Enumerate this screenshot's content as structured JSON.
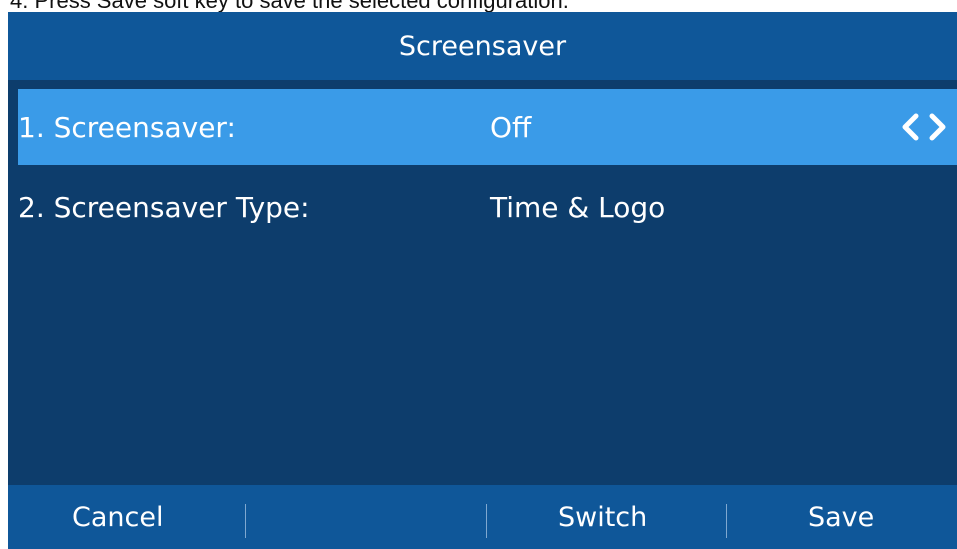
{
  "caption": "4. Press Save soft key to save the selected configuration.",
  "screen": {
    "title": "Screensaver",
    "items": [
      {
        "label": "1. Screensaver:",
        "value": "Off",
        "selected": true
      },
      {
        "label": "2. Screensaver Type:",
        "value": "Time & Logo",
        "selected": false
      }
    ],
    "icons": {
      "prev": "chevron-left-icon",
      "next": "chevron-right-icon"
    }
  },
  "softkeys": {
    "cancel": "Cancel",
    "switch": "Switch",
    "save": "Save"
  },
  "colors": {
    "screen_background": "#0d3d6c",
    "bar_background": "#0f5799",
    "selected_row": "#3a9be8",
    "text": "#ffffff"
  }
}
